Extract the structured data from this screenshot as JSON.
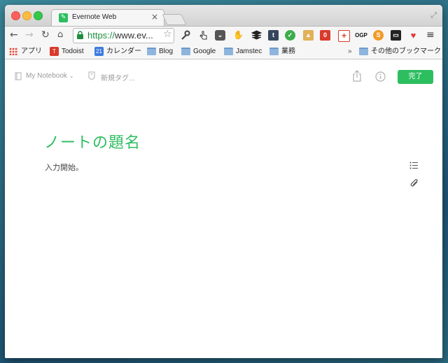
{
  "browser": {
    "tab": {
      "title": "Evernote Web",
      "favicon": "evernote-elephant-icon",
      "close": "×"
    },
    "url": {
      "scheme": "https://",
      "rest": "www.ev..."
    },
    "extensions": [
      {
        "name": "wrench-icon"
      },
      {
        "name": "hand-cursor-icon"
      },
      {
        "name": "pocket-icon"
      },
      {
        "name": "evernote-clipper-icon"
      },
      {
        "name": "buffer-icon"
      },
      {
        "name": "tumblr-icon",
        "text": "t"
      },
      {
        "name": "evernote-green-icon"
      },
      {
        "name": "image-icon"
      },
      {
        "name": "todoist-extension-icon",
        "text": "0"
      },
      {
        "name": "plus-cross-icon"
      },
      {
        "name": "ogp-icon",
        "text": "OGP"
      },
      {
        "name": "s-icon"
      },
      {
        "name": "window-icon"
      },
      {
        "name": "heart-plus-icon"
      },
      {
        "name": "menu-icon"
      }
    ]
  },
  "bookmarks": {
    "items": [
      {
        "label": "アプリ",
        "icon": "apps-grid-icon"
      },
      {
        "label": "Todoist",
        "icon": "todoist-icon"
      },
      {
        "label": "カレンダー",
        "icon": "calendar-icon",
        "badge": "21"
      },
      {
        "label": "Blog",
        "icon": "folder-icon"
      },
      {
        "label": "Google",
        "icon": "folder-icon"
      },
      {
        "label": "Jamstec",
        "icon": "folder-icon"
      },
      {
        "label": "業務",
        "icon": "folder-icon"
      }
    ],
    "overflow": "»",
    "other": "その他のブックマーク"
  },
  "evernote": {
    "notebook": "My Notebook",
    "tags_placeholder": "新規タグ...",
    "done": "完了",
    "note_title": "ノートの題名",
    "note_body": "入力開始。",
    "accent": "#2dbe60"
  }
}
